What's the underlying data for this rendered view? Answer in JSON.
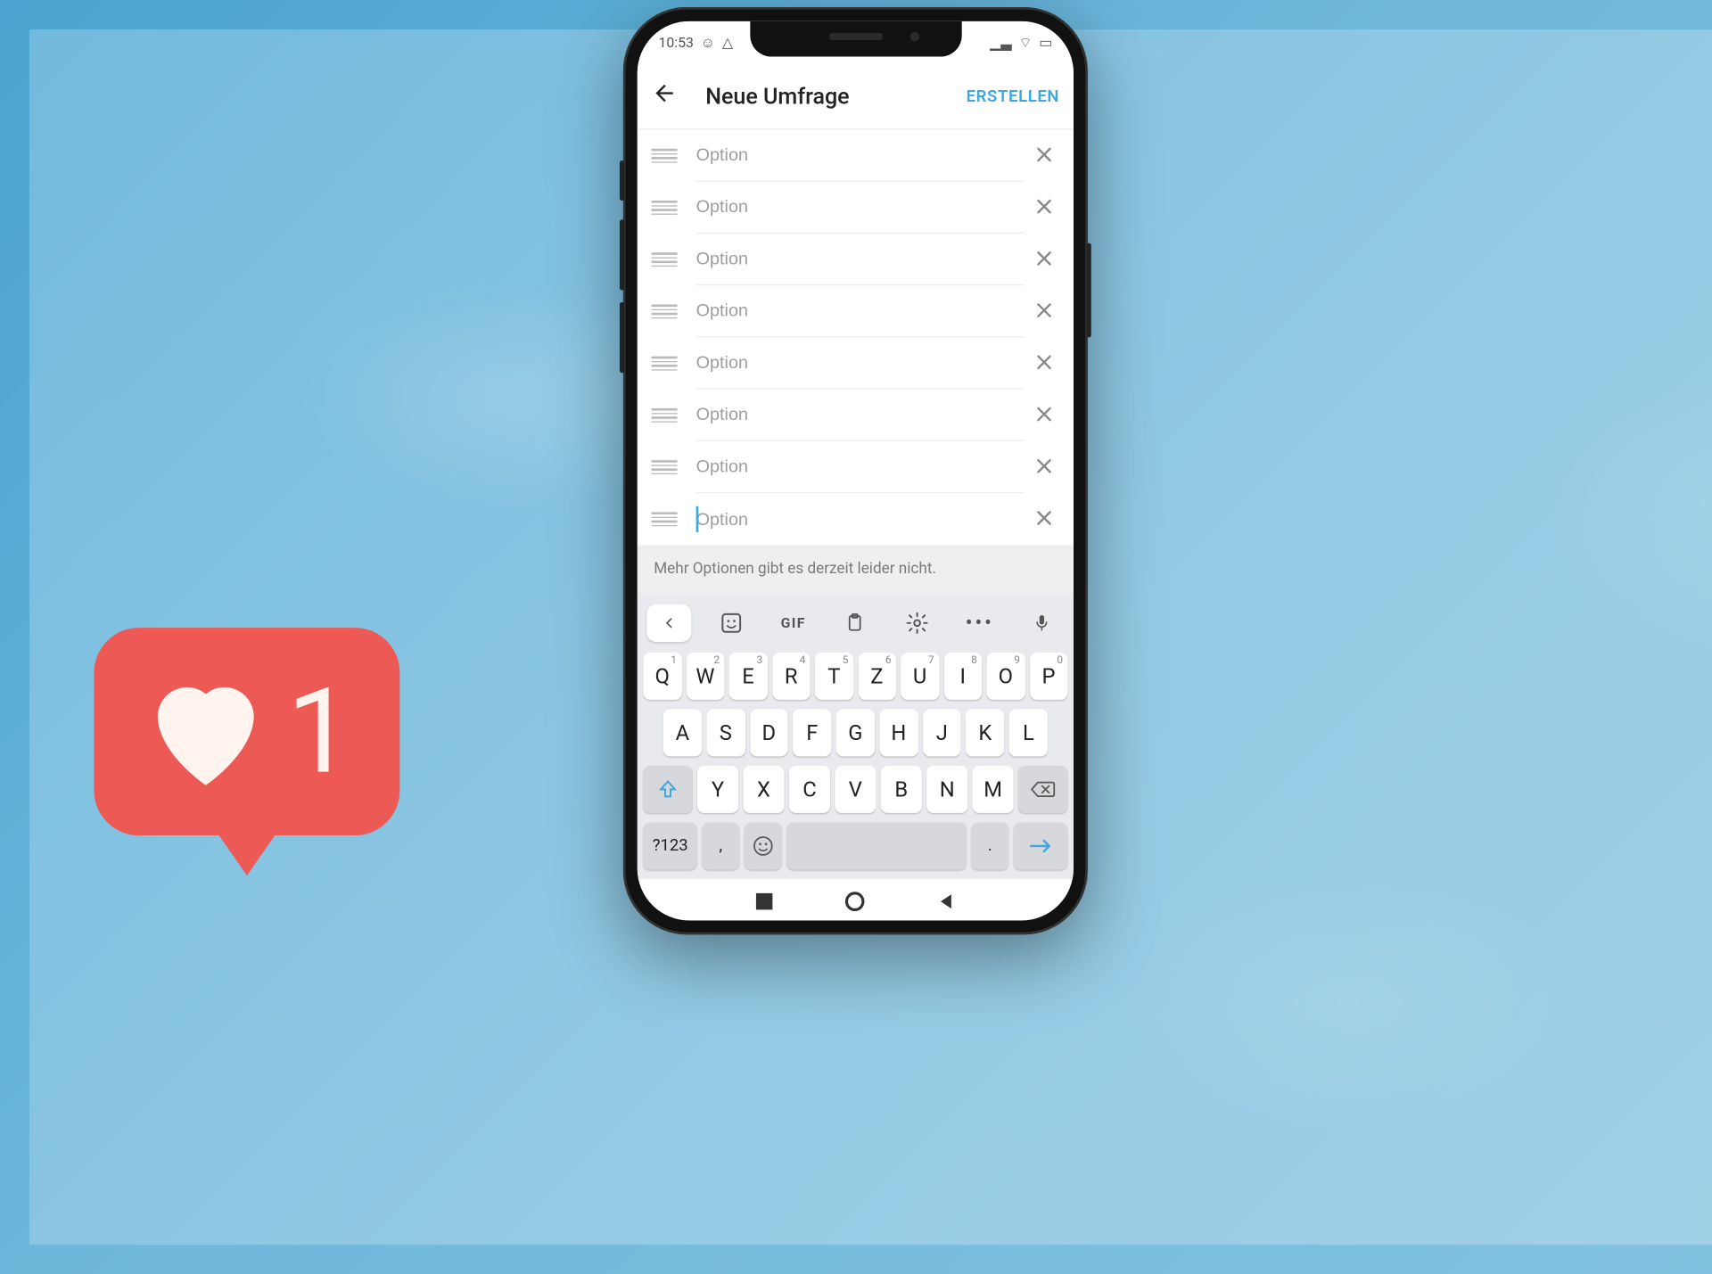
{
  "colors": {
    "accent": "#3ca7e0",
    "badge": "#ed5a56"
  },
  "phone": {
    "status_time": "10:53",
    "header": {
      "title": "Neue Umfrage",
      "action_label": "ERSTELLEN"
    },
    "options": [
      {
        "placeholder": "Option"
      },
      {
        "placeholder": "Option"
      },
      {
        "placeholder": "Option"
      },
      {
        "placeholder": "Option"
      },
      {
        "placeholder": "Option"
      },
      {
        "placeholder": "Option"
      },
      {
        "placeholder": "Option"
      },
      {
        "placeholder": "Option",
        "focused": true
      }
    ],
    "footer_note": "Mehr Optionen gibt es derzeit leider nicht.",
    "keyboard": {
      "toolbar": {
        "gif_label": "GIF"
      },
      "row1": [
        {
          "k": "Q",
          "n": "1"
        },
        {
          "k": "W",
          "n": "2"
        },
        {
          "k": "E",
          "n": "3"
        },
        {
          "k": "R",
          "n": "4"
        },
        {
          "k": "T",
          "n": "5"
        },
        {
          "k": "Z",
          "n": "6"
        },
        {
          "k": "U",
          "n": "7"
        },
        {
          "k": "I",
          "n": "8"
        },
        {
          "k": "O",
          "n": "9"
        },
        {
          "k": "P",
          "n": "0"
        }
      ],
      "row2": [
        "A",
        "S",
        "D",
        "F",
        "G",
        "H",
        "J",
        "K",
        "L"
      ],
      "row3": [
        "Y",
        "X",
        "C",
        "V",
        "B",
        "N",
        "M"
      ],
      "bottom": {
        "symbols": "?123",
        "comma": ",",
        "period": "."
      }
    }
  },
  "like": {
    "count": "1"
  }
}
